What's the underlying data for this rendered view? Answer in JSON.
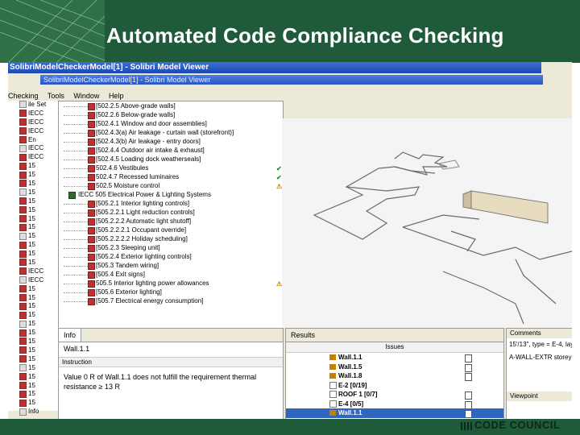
{
  "slide": {
    "title": "Automated Code Compliance Checking",
    "logo_text": "CODE COUNCIL"
  },
  "app": {
    "window_title": "SolibriModelCheckerModel[1] - Solibri Model Viewer",
    "window_title_2": "SolibriModelCheckerModel[1] - Solibri Model Viewer",
    "menu": [
      "Checking",
      "Tools",
      "Window",
      "Help"
    ]
  },
  "left_tree": {
    "rows": [
      "ile  Set",
      "IECC",
      "IECC",
      "IECC",
      "En",
      "IECC",
      "IECC",
      "15",
      "15",
      "15",
      "15",
      "15",
      "15",
      "15",
      "15",
      "15",
      "15",
      "15",
      "15",
      "IECC",
      "IECC",
      "15",
      "15",
      "15",
      "15",
      "15",
      "15",
      "15",
      "15",
      "15",
      "15",
      "15",
      "15",
      "15",
      "15",
      "Info"
    ]
  },
  "ruleset": {
    "rows": [
      {
        "label": "[502.2.5 Above-grade walls]",
        "status": ""
      },
      {
        "label": "[502.2.6 Below-grade walls]",
        "status": ""
      },
      {
        "label": "[502.4.1 Window and door assemblies]",
        "status": ""
      },
      {
        "label": "[502.4.3(a) Air leakage - curtain wall (storefront)]",
        "status": ""
      },
      {
        "label": "[502.4.3(b) Air leakage - entry doors]",
        "status": ""
      },
      {
        "label": "[502.4.4 Outdoor air intake & exhaust]",
        "status": ""
      },
      {
        "label": "[502.4.5 Loading dock weatherseals]",
        "status": ""
      },
      {
        "label": "502.4.6 Vestibules",
        "status": "ok"
      },
      {
        "label": "502.4.7 Recessed luminaires",
        "status": "ok"
      },
      {
        "label": "502.5 Moisture control",
        "status": "warn"
      },
      {
        "label": "IECC 505 Electrical Power & Lighting Systems",
        "status": "",
        "category": true
      },
      {
        "label": "[505.2.1 Interior lighting controls]",
        "status": ""
      },
      {
        "label": "[505.2.2.1 Light reduction controls]",
        "status": ""
      },
      {
        "label": "[505.2.2.2 Automatic light shutoff]",
        "status": ""
      },
      {
        "label": "[505.2.2.2.1 Occupant override]",
        "status": ""
      },
      {
        "label": "[505.2.2.2.2 Holiday scheduling]",
        "status": ""
      },
      {
        "label": "[505.2.3 Sleeping unit]",
        "status": ""
      },
      {
        "label": "[505.2.4 Exterior lighting controls]",
        "status": ""
      },
      {
        "label": "[505.3 Tandem wiring]",
        "status": ""
      },
      {
        "label": "[505.4 Exit signs]",
        "status": ""
      },
      {
        "label": "505.5 Interior lighting power allowances",
        "status": "warn"
      },
      {
        "label": "[505.6 Exterior lighting]",
        "status": ""
      },
      {
        "label": "[505.7 Electrical energy consumption]",
        "status": ""
      }
    ]
  },
  "info": {
    "tab": "Info",
    "name": "Wall.1.1",
    "subtab": "Instruction",
    "text": "Value 0 R of Wall.1.1 does not fulfill the requirement thermal resistance ≥ 13 R"
  },
  "results": {
    "tab": "Results",
    "header": "Issues",
    "rows": [
      {
        "prefix": "",
        "label": "Wall.1.1",
        "type": "warn",
        "doc": true
      },
      {
        "prefix": "",
        "label": "Wall.1.5",
        "type": "warn",
        "doc": true
      },
      {
        "prefix": "",
        "label": "Wall.1.8",
        "type": "warn",
        "doc": true
      },
      {
        "prefix": "",
        "label": "E-2 [0/19]",
        "type": "toggle",
        "doc": false
      },
      {
        "prefix": "",
        "label": "ROOF 1 [0/7]",
        "type": "toggle",
        "doc": true
      },
      {
        "prefix": "",
        "label": "E-4 [0/5]",
        "type": "toggle",
        "doc": true
      },
      {
        "prefix": "",
        "label": "Wall.1.1",
        "type": "warn",
        "doc": true,
        "highlight": true
      }
    ]
  },
  "comments": {
    "title": "Comments",
    "lines": [
      "15'/13\", type = E-4, lay",
      "A-WALL-EXTR storey"
    ],
    "viewpoint": "Viewpoint"
  },
  "colors": {
    "header_green": "#1f5b3a",
    "selection_blue": "#3166c0"
  }
}
